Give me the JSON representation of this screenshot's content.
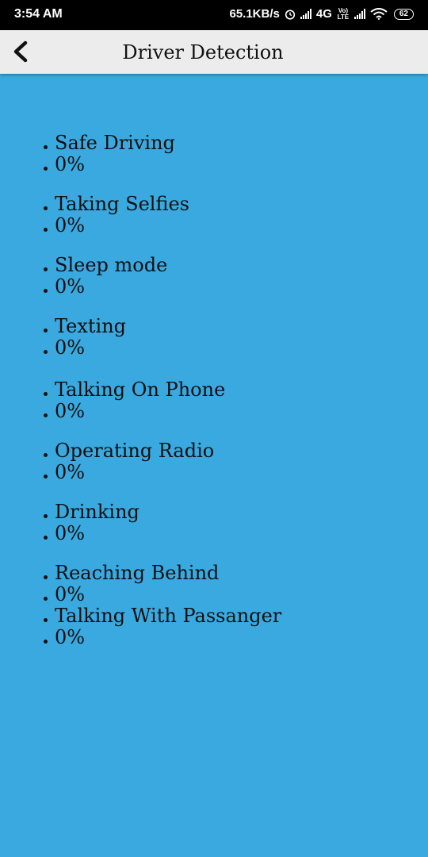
{
  "status_bar": {
    "time": "3:54 AM",
    "speed": "65.1KB/s",
    "network": "4G",
    "volte": "Vo) LTE",
    "battery": "62"
  },
  "app_bar": {
    "title": "Driver Detection",
    "back_icon": "chevron-left-icon"
  },
  "results": [
    {
      "label": "Safe Driving",
      "value": "0%"
    },
    {
      "label": "Taking Selfies",
      "value": "0%"
    },
    {
      "label": "Sleep mode",
      "value": "0%"
    },
    {
      "label": "Texting",
      "value": "0%"
    },
    {
      "label": "Talking On Phone",
      "value": "0%"
    },
    {
      "label": "Operating Radio",
      "value": "0%"
    },
    {
      "label": "Drinking",
      "value": "0%"
    },
    {
      "label": "Reaching Behind",
      "value": "0%"
    },
    {
      "label": "Talking With Passanger",
      "value": "0%"
    }
  ]
}
